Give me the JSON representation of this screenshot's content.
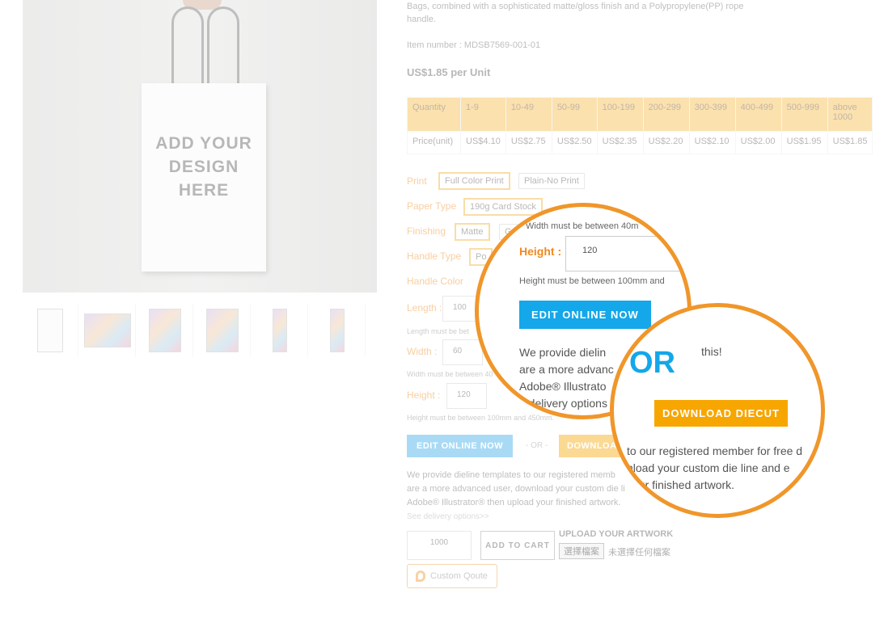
{
  "product": {
    "description": "Bags, combined with a sophisticated matte/gloss finish and a Polypropylene(PP) rope handle.",
    "item_number": "Item number : MDSB7569-001-01",
    "price": "US$1.85 per Unit",
    "bag_text": "ADD YOUR DESIGN HERE"
  },
  "price_table": {
    "quantity_label": "Quantity",
    "price_label": "Price(unit)",
    "quantities": [
      "1-9",
      "10-49",
      "50-99",
      "100-199",
      "200-299",
      "300-399",
      "400-499",
      "500-999",
      "above 1000"
    ],
    "prices": [
      "US$4.10",
      "US$2.75",
      "US$2.50",
      "US$2.35",
      "US$2.20",
      "US$2.10",
      "US$2.00",
      "US$1.95",
      "US$1.85"
    ]
  },
  "options": {
    "print_label": "Print",
    "print_selected": "Full Color Print",
    "print_other": "Plain-No Print",
    "paper_label": "Paper Type",
    "paper_selected": "190g Card Stock",
    "finishing_label": "Finishing",
    "finishing_selected": "Matte",
    "finishing_other": "G",
    "handle_type_label": "Handle Type",
    "handle_type_value": "Po",
    "handle_color_label": "Handle Color",
    "length_label": "Length :",
    "length_value": "100",
    "length_hint": "Length must be bet",
    "width_label": "Width :",
    "width_value": "60",
    "width_hint": "Width must be between 40",
    "height_label": "Height :",
    "height_value": "120",
    "height_hint": "Height must be between 100mm and 450mm."
  },
  "actions": {
    "edit_online": "EDIT ONLINE NOW",
    "or_text": "- OR -",
    "download_diecut": "DOWNLOAD DIECUT",
    "download_short": "DOWNLOA",
    "info_line1": "We provide dieline templates to our registered memb",
    "info_line2": "are a more advanced user, download your custom die li",
    "info_line3": "Adobe® Illustrator® then upload your finished artwork.",
    "delivery_link": "See delivery options>>",
    "qty_value": "1000",
    "add_to_cart": "ADD TO CART",
    "upload_label": "UPLOAD YOUR ARTWORK",
    "choose_file": "選擇檔案",
    "no_file": "未選擇任何檔案",
    "custom_quote": "Custom Qoute"
  },
  "zoom": {
    "width_hint": "Width must be between 40m",
    "height_label": "Height :",
    "height_value": "120",
    "height_hint": "Height must be between 100mm and",
    "edit_online": "EDIT ONLINE NOW",
    "text_line1": "We provide dielin",
    "text_line1_end": "this!",
    "text_line2": "are a more advanc",
    "text_line3": "Adobe® Illustrato",
    "text_line4": "e delivery options",
    "or_big": "OR",
    "download_diecut": "DOWNLOAD DIECUT",
    "text2_line1": "to our registered member for free d",
    "text2_line2": "nload your custom die line and e",
    "text2_line3": "your finished artwork."
  },
  "colors": {
    "accent_orange": "#f0962a",
    "accent_blue": "#14a7e9",
    "table_header": "#f7b940"
  }
}
